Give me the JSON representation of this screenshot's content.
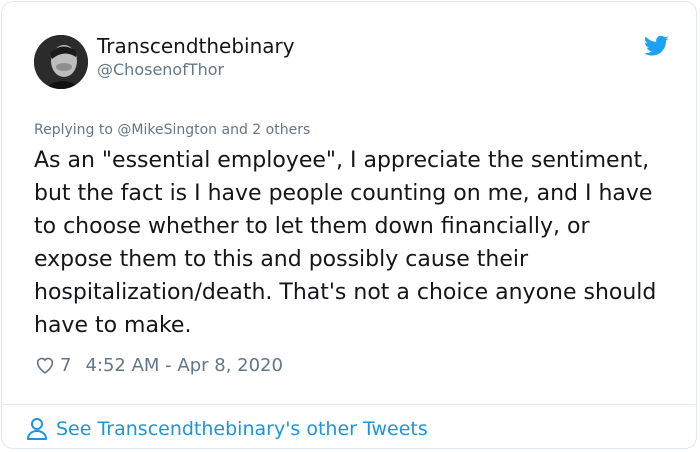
{
  "tweet": {
    "display_name": "Transcendthebinary",
    "handle": "@ChosenofThor",
    "replying_prefix": "Replying to",
    "replying_user": "@MikeSington",
    "replying_and": "and",
    "replying_others": "2 others",
    "text": "As an \"essential employee\", I appreciate the sentiment, but the fact is I have people counting on me, and I have to choose whether to let them down financially, or expose them to this and possibly cause their hospitalization/death. That's not a choice anyone should have to make.",
    "like_count": "7",
    "timestamp": "4:52 AM - Apr 8, 2020"
  },
  "footer": {
    "label": "See Transcendthebinary's other Tweets"
  },
  "icons": {
    "brand": "twitter-bird-icon",
    "like": "heart-icon",
    "profile": "person-icon"
  },
  "colors": {
    "brand_blue": "#1da1f2",
    "link_blue": "#1b95e0",
    "text_primary": "#14171a",
    "text_secondary": "#657786"
  }
}
